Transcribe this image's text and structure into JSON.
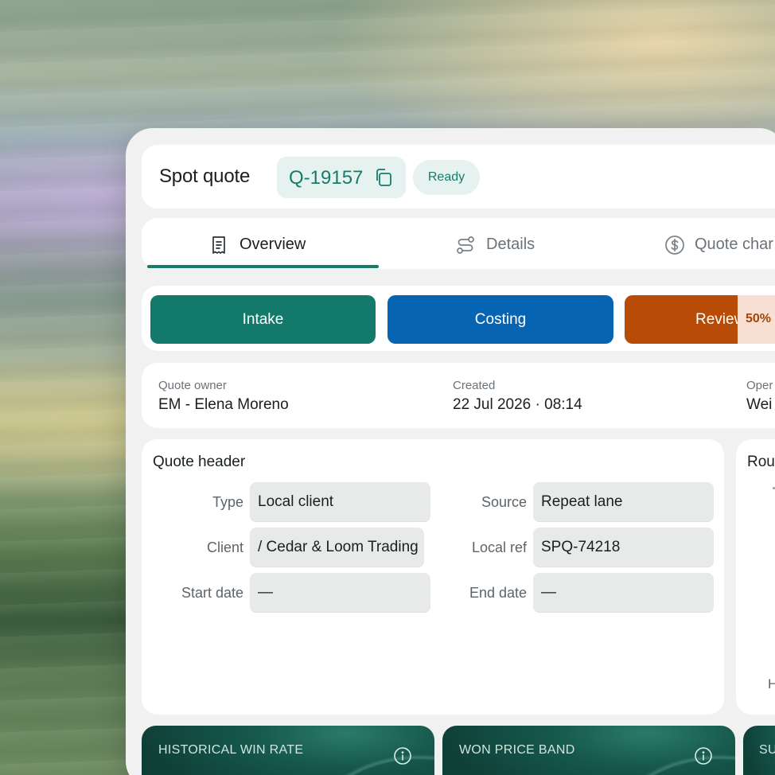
{
  "header": {
    "title": "Spot quote",
    "quote_id": "Q-19157",
    "status": "Ready"
  },
  "tabs": [
    {
      "label": "Overview",
      "icon": "receipt-icon",
      "active": true
    },
    {
      "label": "Details",
      "icon": "route-icon",
      "active": false
    },
    {
      "label": "Quote char",
      "icon": "dollar-circle-icon",
      "active": false
    }
  ],
  "steps": [
    {
      "label": "Intake",
      "color": "#137a6b"
    },
    {
      "label": "Costing",
      "color": "#0764b3"
    },
    {
      "label": "Review",
      "color": "#b84c07",
      "progress_label": "50%",
      "progress": 0.5
    }
  ],
  "meta": [
    {
      "label": "Quote owner",
      "value": "EM - Elena Moreno"
    },
    {
      "label": "Created",
      "value": "22 Jul 2026 · 08:14"
    },
    {
      "label": "Oper",
      "value": "Wei"
    }
  ],
  "quote_header": {
    "title": "Quote header",
    "fields": [
      {
        "label": "Type",
        "value": "Local client"
      },
      {
        "label": "Source",
        "value": "Repeat lane"
      },
      {
        "label": "Client",
        "value": "/ Cedar & Loom Trading"
      },
      {
        "label": "Local ref",
        "value": "SPQ-74218"
      },
      {
        "label": "Start date",
        "value": "—"
      },
      {
        "label": "End date",
        "value": "—"
      }
    ]
  },
  "route_panel": {
    "title": "Rou",
    "axis_label": "H"
  },
  "kpis": [
    {
      "label": "HISTORICAL WIN RATE",
      "icon": "info-icon"
    },
    {
      "label": "WON PRICE BAND",
      "icon": "info-icon"
    },
    {
      "label": "SU",
      "icon": "info-icon"
    }
  ],
  "colors": {
    "accent": "#177b6b",
    "accent_bg": "#e6f2ef",
    "panel_bg": "#f1f1f2"
  }
}
